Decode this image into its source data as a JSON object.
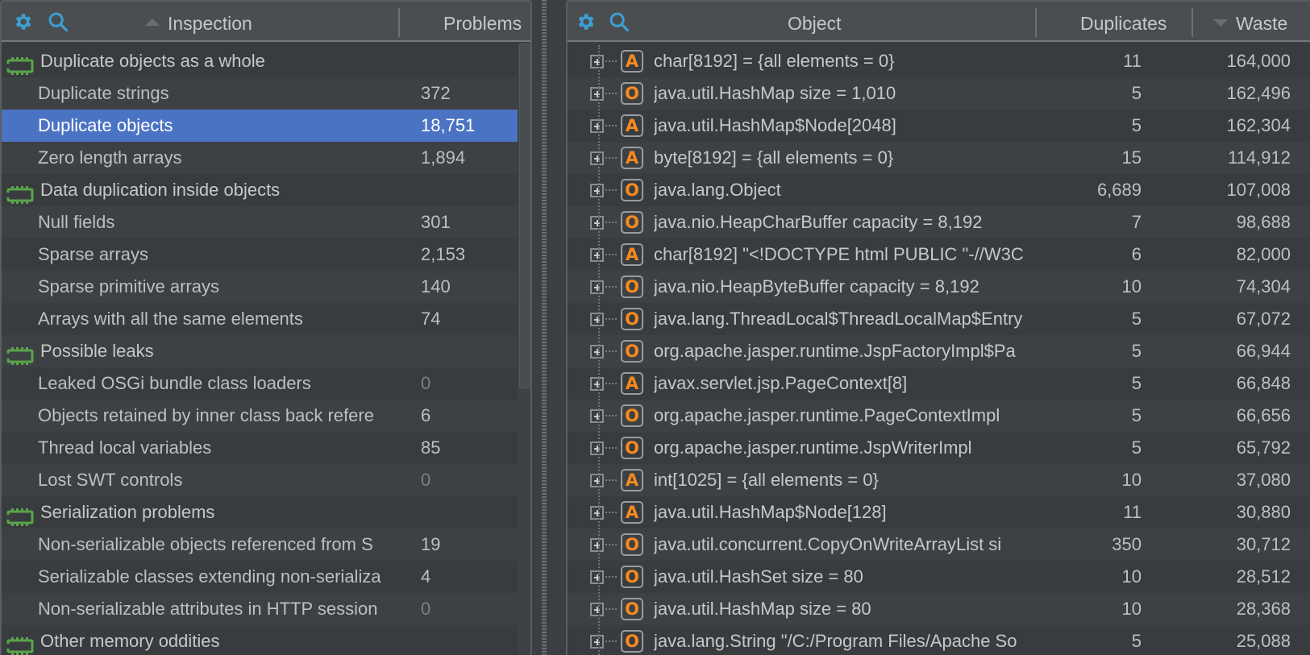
{
  "colors": {
    "accent_selection": "#4b73c3",
    "icon_blue": "#3d9fd1",
    "category_green": "#5aa44b",
    "kind_orange": "#f58a1f"
  },
  "left_panel": {
    "toolbar": {
      "settings_icon": "gear-icon",
      "search_icon": "search-icon"
    },
    "columns": {
      "inspection": "Inspection",
      "problems": "Problems",
      "sort": "ascending"
    },
    "rows": [
      {
        "type": "category",
        "label": "Duplicate objects as a whole"
      },
      {
        "type": "item",
        "label": "Duplicate strings",
        "count": "372"
      },
      {
        "type": "item",
        "label": "Duplicate objects",
        "count": "18,751",
        "selected": true
      },
      {
        "type": "item",
        "label": "Zero length arrays",
        "count": "1,894"
      },
      {
        "type": "category",
        "label": "Data duplication inside objects"
      },
      {
        "type": "item",
        "label": "Null fields",
        "count": "301"
      },
      {
        "type": "item",
        "label": "Sparse arrays",
        "count": "2,153"
      },
      {
        "type": "item",
        "label": "Sparse primitive arrays",
        "count": "140"
      },
      {
        "type": "item",
        "label": "Arrays with all the same elements",
        "count": "74"
      },
      {
        "type": "category",
        "label": "Possible leaks"
      },
      {
        "type": "item",
        "label": "Leaked OSGi bundle class loaders",
        "count": "0"
      },
      {
        "type": "item",
        "label": "Objects retained by inner class back refere",
        "count": "6"
      },
      {
        "type": "item",
        "label": "Thread local variables",
        "count": "85"
      },
      {
        "type": "item",
        "label": "Lost SWT controls",
        "count": "0"
      },
      {
        "type": "category",
        "label": "Serialization problems"
      },
      {
        "type": "item",
        "label": "Non-serializable objects referenced from S",
        "count": "19"
      },
      {
        "type": "item",
        "label": "Serializable classes extending non-serializa",
        "count": "4"
      },
      {
        "type": "item",
        "label": "Non-serializable attributes in HTTP session",
        "count": "0"
      },
      {
        "type": "category",
        "label": "Other memory oddities"
      }
    ]
  },
  "right_panel": {
    "toolbar": {
      "settings_icon": "gear-icon",
      "search_icon": "search-icon"
    },
    "columns": {
      "object": "Object",
      "duplicates": "Duplicates",
      "waste": "Waste",
      "sort": "descending"
    },
    "rows": [
      {
        "kind": "A",
        "label": "char[8192] = {all elements = 0}",
        "duplicates": "11",
        "waste": "164,000"
      },
      {
        "kind": "O",
        "label": "java.util.HashMap   size = 1,010",
        "duplicates": "5",
        "waste": "162,496"
      },
      {
        "kind": "A",
        "label": "java.util.HashMap$Node[2048]",
        "duplicates": "5",
        "waste": "162,304"
      },
      {
        "kind": "A",
        "label": "byte[8192] = {all elements = 0}",
        "duplicates": "15",
        "waste": "114,912"
      },
      {
        "kind": "O",
        "label": "java.lang.Object",
        "duplicates": "6,689",
        "waste": "107,008"
      },
      {
        "kind": "O",
        "label": "java.nio.HeapCharBuffer   capacity = 8,192",
        "duplicates": "7",
        "waste": "98,688"
      },
      {
        "kind": "A",
        "label": "char[8192] \"<!DOCTYPE html PUBLIC \"-//W3C",
        "duplicates": "6",
        "waste": "82,000"
      },
      {
        "kind": "O",
        "label": "java.nio.HeapByteBuffer   capacity = 8,192",
        "duplicates": "10",
        "waste": "74,304"
      },
      {
        "kind": "O",
        "label": "java.lang.ThreadLocal$ThreadLocalMap$Entry",
        "duplicates": "5",
        "waste": "67,072"
      },
      {
        "kind": "O",
        "label": "org.apache.jasper.runtime.JspFactoryImpl$Pa",
        "duplicates": "5",
        "waste": "66,944"
      },
      {
        "kind": "A",
        "label": "javax.servlet.jsp.PageContext[8]",
        "duplicates": "5",
        "waste": "66,848"
      },
      {
        "kind": "O",
        "label": "org.apache.jasper.runtime.PageContextImpl",
        "duplicates": "5",
        "waste": "66,656"
      },
      {
        "kind": "O",
        "label": "org.apache.jasper.runtime.JspWriterImpl",
        "duplicates": "5",
        "waste": "65,792"
      },
      {
        "kind": "A",
        "label": "int[1025] = {all elements = 0}",
        "duplicates": "10",
        "waste": "37,080"
      },
      {
        "kind": "A",
        "label": "java.util.HashMap$Node[128]",
        "duplicates": "11",
        "waste": "30,880"
      },
      {
        "kind": "O",
        "label": "java.util.concurrent.CopyOnWriteArrayList   si",
        "duplicates": "350",
        "waste": "30,712"
      },
      {
        "kind": "O",
        "label": "java.util.HashSet   size = 80",
        "duplicates": "10",
        "waste": "28,512"
      },
      {
        "kind": "O",
        "label": "java.util.HashMap   size = 80",
        "duplicates": "10",
        "waste": "28,368"
      },
      {
        "kind": "O",
        "label": "java.lang.String \"/C:/Program Files/Apache So",
        "duplicates": "5",
        "waste": "25,088"
      }
    ]
  }
}
